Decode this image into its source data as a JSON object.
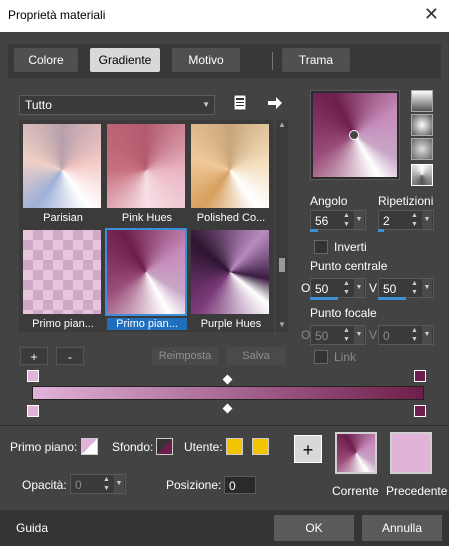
{
  "window": {
    "title": "Proprietà materiali",
    "close_glyph": "✕"
  },
  "tabs": [
    {
      "label": "Colore",
      "active": false
    },
    {
      "label": "Gradiente",
      "active": true
    },
    {
      "label": "Motivo",
      "active": false
    },
    {
      "label": "Trama",
      "active": false
    }
  ],
  "category": {
    "selected": "Tutto"
  },
  "gradients": [
    {
      "label": "Parisian",
      "selected": false
    },
    {
      "label": "Pink Hues",
      "selected": false
    },
    {
      "label": "Polished Co...",
      "selected": false
    },
    {
      "label": "Primo pian...",
      "selected": false
    },
    {
      "label": "Primo pian...",
      "selected": true
    },
    {
      "label": "Purple Hues",
      "selected": false
    }
  ],
  "buttons": {
    "plus": "+",
    "minus": "-",
    "reset": "Reimposta",
    "save": "Salva",
    "add": "+",
    "ok": "OK",
    "cancel": "Annulla"
  },
  "angle": {
    "label": "Angolo",
    "value": "56"
  },
  "repeats": {
    "label": "Ripetizioni",
    "value": "2"
  },
  "invert": {
    "label": "Inverti",
    "checked": false
  },
  "center": {
    "label": "Punto centrale",
    "o_label": "O",
    "o_value": "50",
    "v_label": "V",
    "v_value": "50"
  },
  "focal": {
    "label": "Punto focale",
    "o_label": "O",
    "o_value": "50",
    "v_label": "V",
    "v_value": "0"
  },
  "link": {
    "label": "Link",
    "checked": false
  },
  "bottom": {
    "foreground_label": "Primo piano:",
    "background_label": "Sfondo:",
    "user_label": "Utente:",
    "opacity_label": "Opacità:",
    "opacity_value": "0",
    "position_label": "Posizione:",
    "position_value": "0",
    "current_label": "Corrente",
    "previous_label": "Precedente"
  },
  "footer": {
    "help": "Guida"
  },
  "colors": {
    "accent": "#3d8fd6",
    "user_swatch": "#f5c400",
    "previous": "#e2b3d9",
    "foreground": "#e2b3d9",
    "background": "#6e1e4a"
  }
}
